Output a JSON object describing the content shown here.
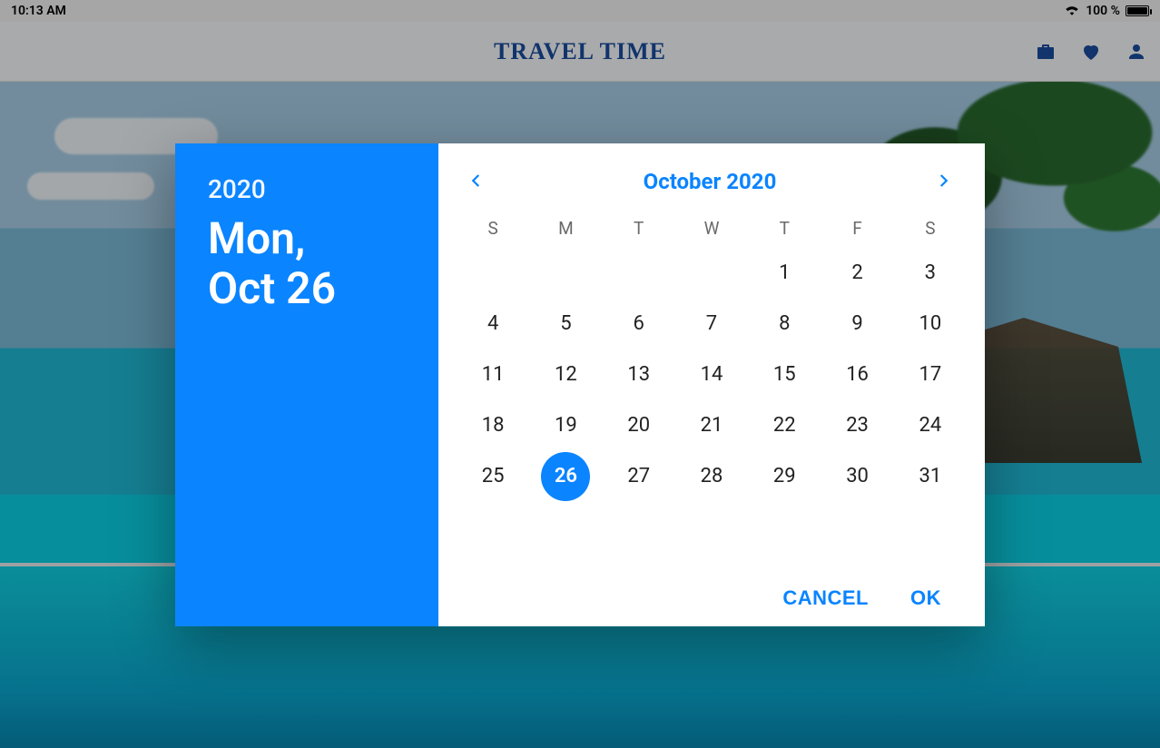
{
  "statusbar": {
    "time": "10:13 AM",
    "battery_text": "100 %"
  },
  "appbar": {
    "title": "TRAVEL TIME"
  },
  "dialog": {
    "year": "2020",
    "date_line1": "Mon,",
    "date_line2": "Oct 26",
    "month_label": "October 2020",
    "weekdays": [
      "S",
      "M",
      "T",
      "W",
      "T",
      "F",
      "S"
    ],
    "leading_blanks": 4,
    "days": [
      1,
      2,
      3,
      4,
      5,
      6,
      7,
      8,
      9,
      10,
      11,
      12,
      13,
      14,
      15,
      16,
      17,
      18,
      19,
      20,
      21,
      22,
      23,
      24,
      25,
      26,
      27,
      28,
      29,
      30,
      31
    ],
    "selected_day": 26,
    "cancel_label": "CANCEL",
    "ok_label": "OK"
  }
}
